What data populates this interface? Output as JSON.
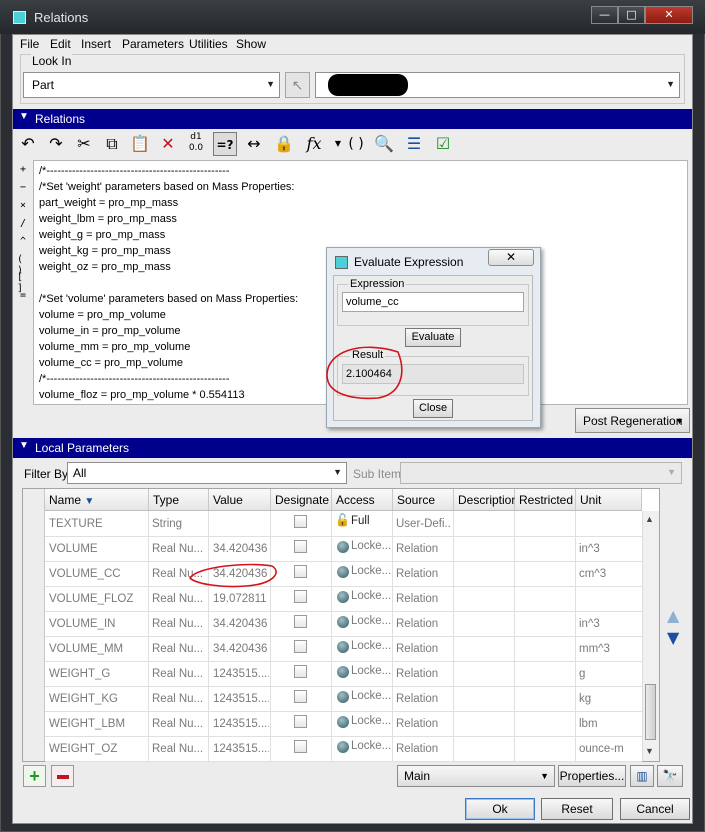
{
  "window": {
    "title": "Relations"
  },
  "menu": [
    "File",
    "Edit",
    "Insert",
    "Parameters",
    "Utilities",
    "Show"
  ],
  "look_in": {
    "label": "Look In",
    "type_value": "Part",
    "model_value": ""
  },
  "relations_section": {
    "label": "Relations"
  },
  "toolbar_icons": [
    "undo-icon",
    "redo-icon",
    "cut-icon",
    "copy-icon",
    "paste-icon",
    "delete-icon",
    "units-icon",
    "evaluate-icon",
    "dimension-icon",
    "lock-icon",
    "function-icon",
    "parentheses-icon",
    "verify-icon",
    "sort-icon",
    "check-icon"
  ],
  "toolbar_labels": {
    "function": "fx",
    "parentheses": "( )",
    "evaluate": "=?"
  },
  "operators": [
    "+",
    "−",
    "×",
    "/",
    "^",
    "( )",
    "[ ]",
    "="
  ],
  "relations": [
    "/*--------------------------------------------------",
    "/*Set 'weight' parameters based on Mass Properties:",
    "part_weight = pro_mp_mass",
    "weight_lbm = pro_mp_mass",
    "weight_g = pro_mp_mass",
    "weight_kg = pro_mp_mass",
    "weight_oz = pro_mp_mass",
    "",
    "/*Set 'volume' parameters based on Mass Properties:",
    "volume = pro_mp_volume",
    "volume_in = pro_mp_volume",
    "volume_mm = pro_mp_volume",
    "volume_cc = pro_mp_volume",
    "/*--------------------------------------------------",
    "volume_floz = pro_mp_volume * 0.554113"
  ],
  "post_regen": "Post Regeneration",
  "evaluate_dialog": {
    "title": "Evaluate Expression",
    "close_label": "Close",
    "expression_label": "Expression",
    "expression_value": "volume_cc",
    "evaluate_label": "Evaluate",
    "result_label": "Result",
    "result_value": "2.100464"
  },
  "local_params": {
    "label": "Local Parameters",
    "filter_label": "Filter By",
    "filter_value": "All",
    "subitems_label": "Sub Items",
    "columns": [
      "Name",
      "Type",
      "Value",
      "Designate",
      "Access",
      "Source",
      "Description",
      "Restricted",
      "Unit"
    ],
    "rows": [
      {
        "name": "TEXTURE",
        "type": "String",
        "value": "",
        "access": "Full",
        "source": "User-Defi...",
        "unit": "",
        "locked": false
      },
      {
        "name": "VOLUME",
        "type": "Real Nu...",
        "value": "34.420436",
        "access": "Locke...",
        "source": "Relation",
        "unit": "in^3",
        "locked": true
      },
      {
        "name": "VOLUME_CC",
        "type": "Real Nu...",
        "value": "34.420436",
        "access": "Locke...",
        "source": "Relation",
        "unit": "cm^3",
        "locked": true
      },
      {
        "name": "VOLUME_FLOZ",
        "type": "Real Nu...",
        "value": "19.072811",
        "access": "Locke...",
        "source": "Relation",
        "unit": "",
        "locked": true
      },
      {
        "name": "VOLUME_IN",
        "type": "Real Nu...",
        "value": "34.420436",
        "access": "Locke...",
        "source": "Relation",
        "unit": "in^3",
        "locked": true
      },
      {
        "name": "VOLUME_MM",
        "type": "Real Nu...",
        "value": "34.420436",
        "access": "Locke...",
        "source": "Relation",
        "unit": "mm^3",
        "locked": true
      },
      {
        "name": "WEIGHT_G",
        "type": "Real Nu...",
        "value": "1243515....",
        "access": "Locke...",
        "source": "Relation",
        "unit": "g",
        "locked": true
      },
      {
        "name": "WEIGHT_KG",
        "type": "Real Nu...",
        "value": "1243515....",
        "access": "Locke...",
        "source": "Relation",
        "unit": "kg",
        "locked": true
      },
      {
        "name": "WEIGHT_LBM",
        "type": "Real Nu...",
        "value": "1243515....",
        "access": "Locke...",
        "source": "Relation",
        "unit": "lbm",
        "locked": true
      },
      {
        "name": "WEIGHT_OZ",
        "type": "Real Nu...",
        "value": "1243515....",
        "access": "Locke...",
        "source": "Relation",
        "unit": "ounce-m",
        "locked": true
      }
    ],
    "main_value": "Main",
    "properties_label": "Properties..."
  },
  "buttons": {
    "ok": "Ok",
    "reset": "Reset",
    "cancel": "Cancel"
  },
  "colors": {
    "section_header": "#00008c",
    "annotation_red": "#d4141a",
    "accent_blue": "#1b4fa0"
  }
}
